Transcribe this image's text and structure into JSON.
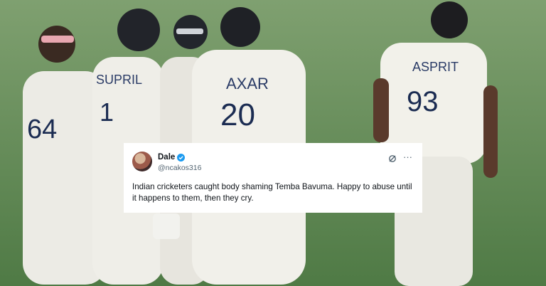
{
  "photo": {
    "jersey_names": [
      "SUPRIL",
      "AXAR",
      "ASPRIT"
    ],
    "jersey_numbers": [
      "64",
      "1",
      "20",
      "93"
    ]
  },
  "tweet": {
    "display_name": "Dale",
    "handle": "@ncakos316",
    "text": "Indian cricketers caught body shaming Temba Bavuma. Happy to abuse until it happens to them, then they cry.",
    "more_glyph": "···",
    "verified_color": "#1d9bf0"
  }
}
